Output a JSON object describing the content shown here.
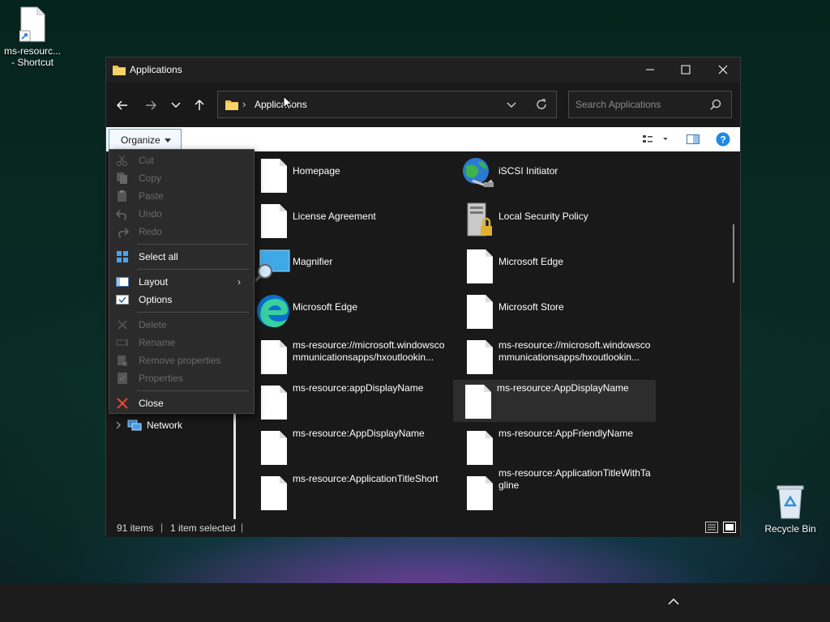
{
  "desktop": {
    "shortcut_label_1": "ms-resourc...",
    "shortcut_label_2": "- Shortcut",
    "recycle_label": "Recycle Bin"
  },
  "window": {
    "title": "Applications",
    "address_path": "Applications",
    "search_placeholder": "Search Applications",
    "organize_label": "Organize"
  },
  "menu": {
    "items": [
      {
        "label": "Cut",
        "enabled": false
      },
      {
        "label": "Copy",
        "enabled": false
      },
      {
        "label": "Paste",
        "enabled": false
      },
      {
        "label": "Undo",
        "enabled": false
      },
      {
        "label": "Redo",
        "enabled": false
      },
      {
        "label": "Select all",
        "enabled": true
      },
      {
        "label": "Layout",
        "enabled": true
      },
      {
        "label": "Options",
        "enabled": true
      },
      {
        "label": "Delete",
        "enabled": false
      },
      {
        "label": "Rename",
        "enabled": false
      },
      {
        "label": "Remove properties",
        "enabled": false
      },
      {
        "label": "Properties",
        "enabled": false
      },
      {
        "label": "Close",
        "enabled": true
      }
    ]
  },
  "nav": {
    "network_label": "Network"
  },
  "files": [
    {
      "name": "Homepage",
      "icon": "document-icon"
    },
    {
      "name": "iSCSI Initiator",
      "icon": "globe-network-icon"
    },
    {
      "name": "License Agreement",
      "icon": "document-icon"
    },
    {
      "name": "Local Security Policy",
      "icon": "server-lock-icon"
    },
    {
      "name": "Magnifier",
      "icon": "magnifier-icon"
    },
    {
      "name": "Microsoft Edge",
      "icon": "document-icon"
    },
    {
      "name": "Microsoft Edge",
      "icon": "edge-icon"
    },
    {
      "name": "Microsoft Store",
      "icon": "document-icon"
    },
    {
      "name": "ms-resource://microsoft.windowscommunicationsapps/hxoutlookin...",
      "icon": "document-icon"
    },
    {
      "name": "ms-resource://microsoft.windowscommunicationsapps/hxoutlookin...",
      "icon": "document-icon"
    },
    {
      "name": "ms-resource:appDisplayName",
      "icon": "document-icon"
    },
    {
      "name": "ms-resource:AppDisplayName",
      "icon": "document-icon",
      "selected": true
    },
    {
      "name": "ms-resource:AppDisplayName",
      "icon": "document-icon"
    },
    {
      "name": "ms-resource:AppFriendlyName",
      "icon": "document-icon"
    },
    {
      "name": "ms-resource:ApplicationTitleShort",
      "icon": "document-icon"
    },
    {
      "name": "ms-resource:ApplicationTitleWithTagline",
      "icon": "document-icon"
    }
  ],
  "status": {
    "item_count": "91 items",
    "selection": "1 item selected"
  },
  "colors": {
    "accent": "#0078d4",
    "close_red": "#e04a3a",
    "help_blue": "#1e88e5"
  }
}
